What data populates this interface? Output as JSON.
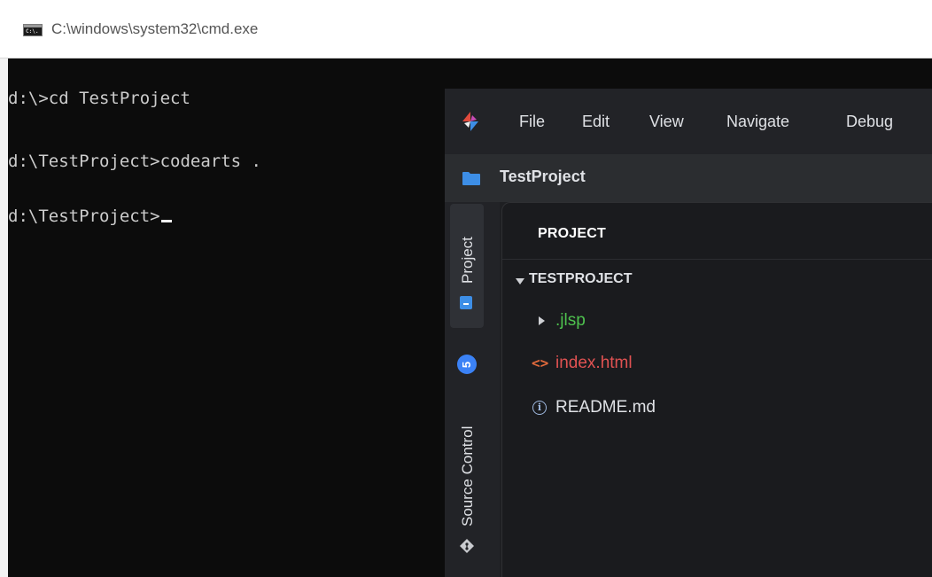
{
  "cmd": {
    "title": "C:\\windows\\system32\\cmd.exe",
    "icon_text": "C:\\.",
    "lines": [
      "d:\\>cd TestProject",
      "d:\\TestProject>codearts .",
      "d:\\TestProject>"
    ]
  },
  "ide": {
    "menu": [
      "File",
      "Edit",
      "View",
      "Navigate",
      "Debug"
    ],
    "breadcrumb": "TestProject",
    "activity": {
      "project_label": "Project",
      "source_control_label": "Source Control",
      "source_control_badge": "5"
    },
    "panel": {
      "title": "PROJECT",
      "root": "TESTPROJECT",
      "items": [
        {
          "name": ".jlsp",
          "icon": "chevron-right-icon",
          "color": "#4ec14e"
        },
        {
          "name": "index.html",
          "icon": "html-tag-icon",
          "color": "#e05252"
        },
        {
          "name": "README.md",
          "icon": "info-icon",
          "color": "#dfe1e5"
        }
      ]
    }
  }
}
